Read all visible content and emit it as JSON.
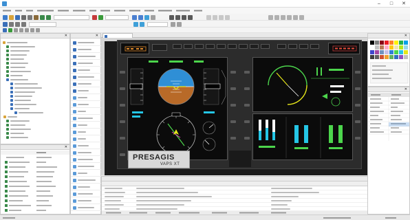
{
  "window": {
    "title": "",
    "min_glyph": "–",
    "max_glyph": "□",
    "close_glyph": "✕"
  },
  "menu": {
    "items": [
      "",
      "",
      "",
      "",
      "",
      "",
      "",
      "",
      "",
      "",
      "",
      "",
      "",
      ""
    ]
  },
  "toolbar": {
    "field_1": "",
    "field_2": "",
    "field_3": "",
    "field_4": ""
  },
  "left_panel": {
    "title": ""
  },
  "objects_panel": {
    "title": ""
  },
  "canvas": {
    "tab_label": "",
    "brand": "PRESAGIS",
    "product": "VAPS XT"
  },
  "right_panel": {
    "title": ""
  },
  "props_panel": {
    "title": ""
  },
  "bottom_left_panel": {
    "title": ""
  },
  "prop_table": {
    "title": "",
    "col_1": "",
    "col_2": ""
  },
  "status": {
    "left": "",
    "right": ""
  },
  "icons": {
    "app": "app-icon",
    "save": "save-icon",
    "open": "open-icon",
    "undo": "undo-icon",
    "redo": "redo-icon",
    "zoom": "zoom-icon",
    "grid": "grid-icon",
    "play": "play-icon"
  },
  "colors": {
    "canvas_bg": "#1b1b1b",
    "display_bg": "#0b0b0b",
    "attitude_sky": "#2f8fd6",
    "attitude_ground": "#b86a28",
    "symbology_green": "#4cd54c",
    "symbology_yellow": "#e6e61a",
    "symbology_cyan": "#25c6e6",
    "selection": "#2f7fd6"
  }
}
